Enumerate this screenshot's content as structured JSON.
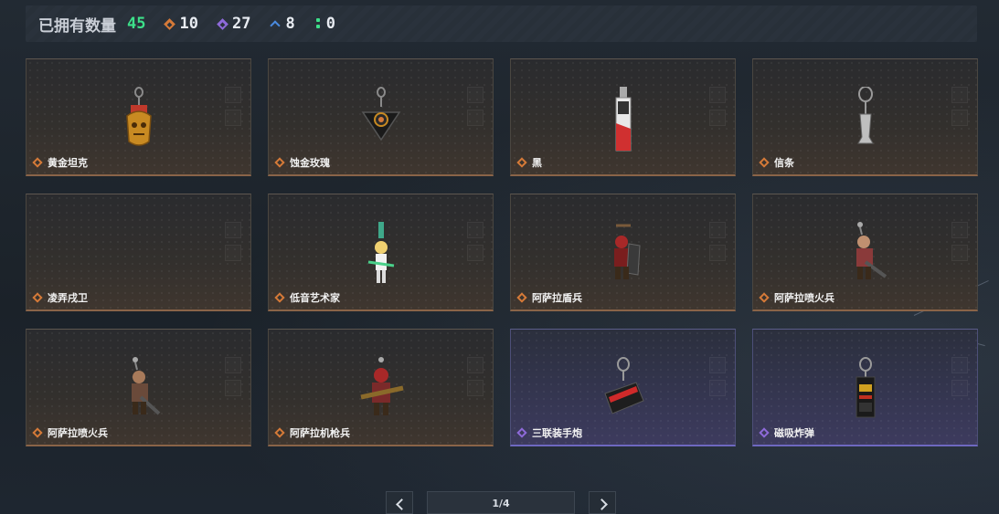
{
  "summary": {
    "title": "已拥有数量",
    "total": "45",
    "counts": [
      {
        "icon": "orange-diamond-icon",
        "value": "10",
        "color": "#d67a38"
      },
      {
        "icon": "purple-diamond-icon",
        "value": "27",
        "color": "#8e6ad9"
      },
      {
        "icon": "blue-chevron-icon",
        "value": "8",
        "color": "#4a8be0"
      },
      {
        "icon": "green-dots-icon",
        "value": "0",
        "color": "#3de08a"
      }
    ]
  },
  "items": [
    {
      "name": "黄金坦克",
      "rarity": "orange"
    },
    {
      "name": "蚀金玫瑰",
      "rarity": "orange"
    },
    {
      "name": "黑",
      "rarity": "orange"
    },
    {
      "name": "信条",
      "rarity": "orange"
    },
    {
      "name": "凌弄戌卫",
      "rarity": "orange"
    },
    {
      "name": "低音艺术家",
      "rarity": "orange"
    },
    {
      "name": "阿萨拉盾兵",
      "rarity": "orange"
    },
    {
      "name": "阿萨拉喷火兵",
      "rarity": "orange"
    },
    {
      "name": "阿萨拉喷火兵",
      "rarity": "orange"
    },
    {
      "name": "阿萨拉机枪兵",
      "rarity": "orange"
    },
    {
      "name": "三联装手炮",
      "rarity": "purple"
    },
    {
      "name": "磁吸炸弹",
      "rarity": "purple"
    }
  ],
  "pagination": {
    "current": "1/4"
  },
  "colors": {
    "rarity_orange": "#d67a38",
    "rarity_purple": "#8e6ad9",
    "total_green": "#3de08a"
  }
}
